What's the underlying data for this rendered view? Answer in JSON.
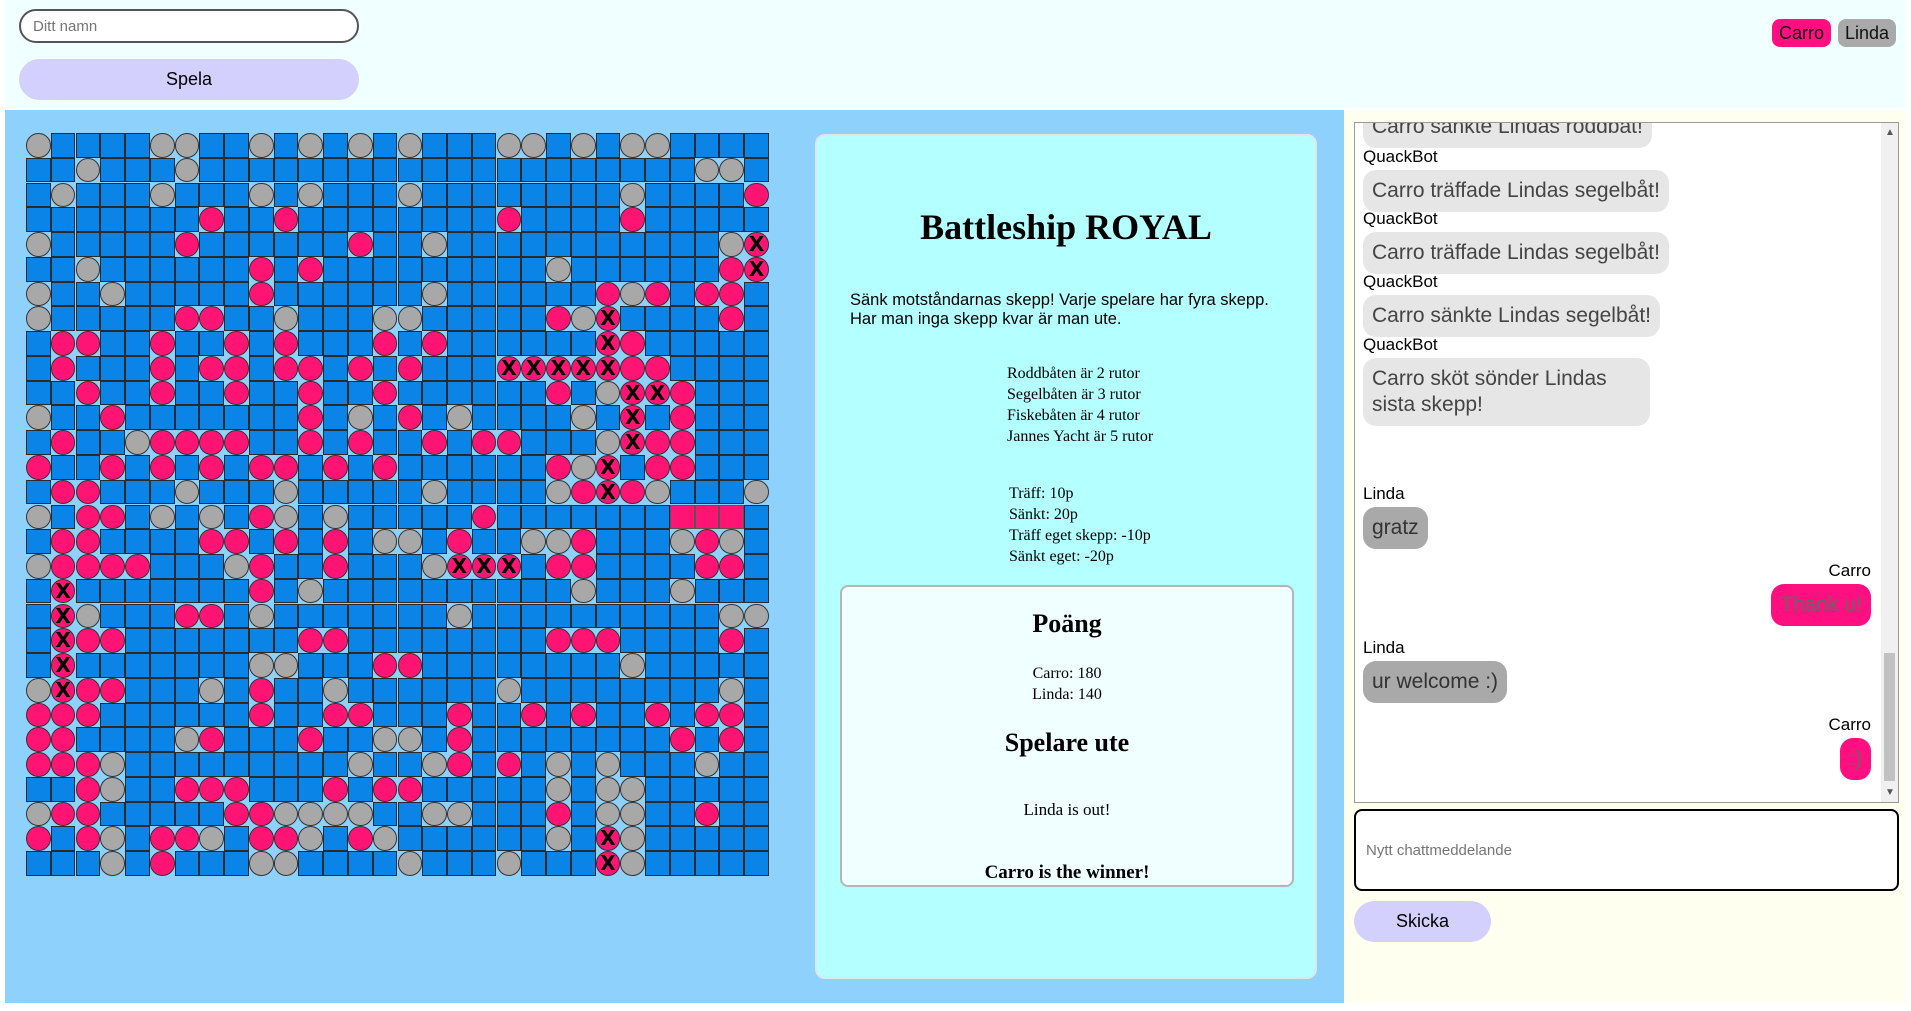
{
  "header": {
    "name_placeholder": "Ditt namn",
    "play_label": "Spela",
    "players": [
      {
        "name": "Carro",
        "color": "#ff0f80"
      },
      {
        "name": "Linda",
        "color": "#a9a9a9"
      }
    ]
  },
  "board": {
    "size": 30,
    "legend": {
      "W": "water",
      "M": "miss",
      "H": "hit",
      "S": "ship-square",
      "X": "sunk-marker"
    },
    "rows": [
      "MWWWWMMWWMWMWMWMWWWMMWMWMMWWWW",
      "WWMWWWMWWWWWWWWWWWWWWWWWWWWMMW",
      "WMWWWMWWWMWMWWWMWWWWWWWWMWWWWH",
      "WWWWWWWHWWHWWWWWWWWHWWWWHWWWWW",
      "MWWWWWHWWWWWWHWWMWWWWWWWWWWWMX",
      "WWMWWWWWWHWHWWWWWWWWWMWWWWWWHX",
      "MWWMWWWWWHWWWWWWMWWWWWWHMHWHHW",
      "MWWWWWHHWWMWWWMMWWWWWHMXWWWWHW",
      "WHHWWHWWHWHWWWHWHWWWWWWXHWWWWW",
      "WHWWWHWHHWHHWHWHWWWXXXXXHHWWWW",
      "WWHWWHWWHWWHWWHWWWWWWHWMXXHWWW",
      "MWWHWWWWWWWHWMWHWMWWWWMWXWHWWW",
      "WHWWMHHHHWWHWHWWHWHHWWWMXHHWWW",
      "HWWHWHWHWHHWHWHWWWWWWHMXWHHWWW",
      "WHHWWWMWWWMWWWWWMWWWWMHXHMWWWM",
      "MWHHWMWMWHMWMWWWWWHWWWWWWWSSSW",
      "WHHWWWWHHWHWHWMMWHWWMMHWWWMHMW",
      "MHHHHWWWMHWWHWWWMXXXWHHWWWWHHW",
      "WXWWWWWWWHWMWWWWWWWWWWMWWWMWWW",
      "WXMWWWHHWMWWWWWWWMWWWWWWWWWWMM",
      "WXHHWWWWWWWHHWWWWWWWWHHHWWWWHW",
      "WXWWWWWWWMMWWWHHWWWWWWWWMWWWWW",
      "MXHHWWWMWHWWMWWWWWWMWWWWWWWWMW",
      "HHHWWWWWWHWWHHWWWHWWHWHWWHWHHW",
      "HHWWWWMHWWWHWWMMWHWWWWWWWWHWHW",
      "HHHMWWWWWWWWWMWWMHWHWMWMWWWMWW",
      "WWHMWWHHHWWWHWHHWWWWWMWMMWWWWW",
      "MHHWWWWWHHMMMMWWMMWWWHWMMWWHWW",
      "HWHMWHHMWHHMWHMWWWWWWMWXMWWWWW",
      "WWWMWHWWWMMWWWWMWWWMWWWXMWWWWW"
    ]
  },
  "info": {
    "title": "Battleship ROYAL",
    "intro": "Sänk motståndarnas skepp! Varje spelare har fyra skepp. Har man inga skepp kvar är man ute.",
    "ship_rules": [
      "Roddbåten är 2 rutor",
      "Segelbåten är 3 rutor",
      "Fiskebåten är 4 rutor",
      "Jannes Yacht är 5 rutor"
    ],
    "point_rules": [
      "Träff: 10p",
      "Sänkt: 20p",
      "Träff eget skepp: -10p",
      "Sänkt eget: -20p"
    ],
    "score_heading": "Poäng",
    "scores": [
      "Carro: 180",
      "Linda: 140"
    ],
    "out_heading": "Spelare ute",
    "out_text": "Linda is out!",
    "winner_text": "Carro is the winner!"
  },
  "chat": {
    "messages": [
      {
        "sender": "",
        "text": "Carro sänkte Lindas roddbåt!",
        "type": "bot"
      },
      {
        "sender": "QuackBot",
        "text": "Carro träffade Lindas segelbåt!",
        "type": "bot"
      },
      {
        "sender": "QuackBot",
        "text": "Carro träffade Lindas segelbåt!",
        "type": "bot"
      },
      {
        "sender": "QuackBot",
        "text": "Carro sänkte Lindas segelbåt!",
        "type": "bot"
      },
      {
        "sender": "QuackBot",
        "text": "Carro sköt sönder Lindas sista skepp!",
        "type": "bot"
      },
      {
        "sender": "Linda",
        "text": "gratz",
        "type": "linda"
      },
      {
        "sender": "Carro",
        "text": "Thank u!",
        "type": "carro"
      },
      {
        "sender": "Linda",
        "text": "ur welcome :)",
        "type": "linda"
      },
      {
        "sender": "Carro",
        "text": ":)",
        "type": "carro"
      }
    ],
    "input_placeholder": "Nytt chattmeddelande",
    "send_label": "Skicka"
  }
}
